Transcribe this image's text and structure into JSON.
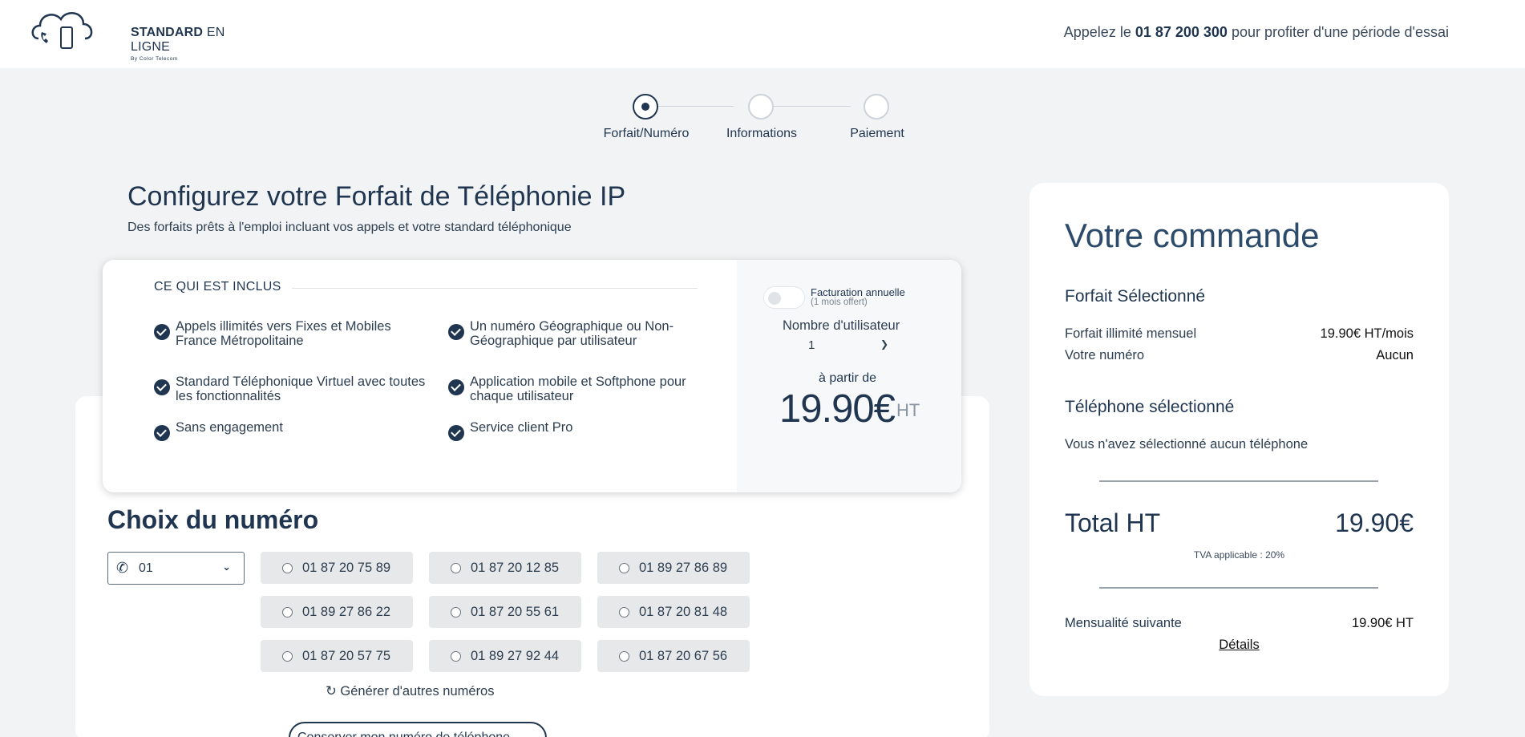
{
  "header": {
    "logo_bold": "STANDARD",
    "logo_rest": " EN LIGNE",
    "logo_sub": "By Color Telecom",
    "call_prefix": "Appelez le ",
    "call_phone": "01 87 200 300",
    "call_suffix": " pour profiter d'une période d'essai"
  },
  "stepper": {
    "steps": [
      {
        "label": "Forfait/Numéro",
        "active": true
      },
      {
        "label": "Informations",
        "active": false
      },
      {
        "label": "Paiement",
        "active": false
      }
    ]
  },
  "intro": {
    "title": "Configurez votre Forfait de Téléphonie IP",
    "subtitle": "Des forfaits prêts à l'emploi incluant vos appels et votre standard téléphonique"
  },
  "included": {
    "title": "CE QUI EST INCLUS",
    "features": [
      "Appels illimités vers Fixes et Mobiles France Métropolitaine",
      "Un numéro Géographique ou Non-Géographique par utilisateur",
      "Standard Téléphonique Virtuel avec toutes les fonctionnalités",
      "Application mobile et Softphone pour chaque utilisateur",
      "Sans engagement",
      "Service client Pro"
    ],
    "annual_label": "Facturation annuelle",
    "annual_sub": "(1 mois offert)",
    "annual_enabled": false,
    "users_label": "Nombre d'utilisateur",
    "users_value": "1",
    "from_label": "à partir de",
    "price": "19.90€",
    "price_unit": "HT"
  },
  "numbers": {
    "title": "Choix du numéro",
    "prefix_value": "01",
    "options": [
      "01 87 20 75 89",
      "01 87 20 12 85",
      "01 89 27 86 89",
      "01 89 27 86 22",
      "01 87 20 55 61",
      "01 87 20 81 48",
      "01 87 20 57 75",
      "01 89 27 92 44",
      "01 87 20 67 56"
    ],
    "generate_label": "↻ Générer d'autres numéros",
    "keep_label": "Conserver mon numéro de téléphone"
  },
  "order": {
    "title": "Votre commande",
    "plan_section": "Forfait Sélectionné",
    "plan_name": "Forfait illimité mensuel",
    "plan_price": "19.90€ HT/mois",
    "number_label": "Votre numéro",
    "number_value": "Aucun",
    "phone_section": "Téléphone sélectionné",
    "phone_none": "Vous n'avez sélectionné aucun téléphone",
    "total_label": "Total HT",
    "total_value": "19.90€",
    "tva": "TVA applicable : 20%",
    "next_label": "Mensualité suivante",
    "next_value": "19.90€ HT",
    "details": "Détails"
  },
  "colors": {
    "brand_navy": "#1f3550",
    "page_bg": "#f2f3f4",
    "option_bg": "#e7e8e9"
  }
}
